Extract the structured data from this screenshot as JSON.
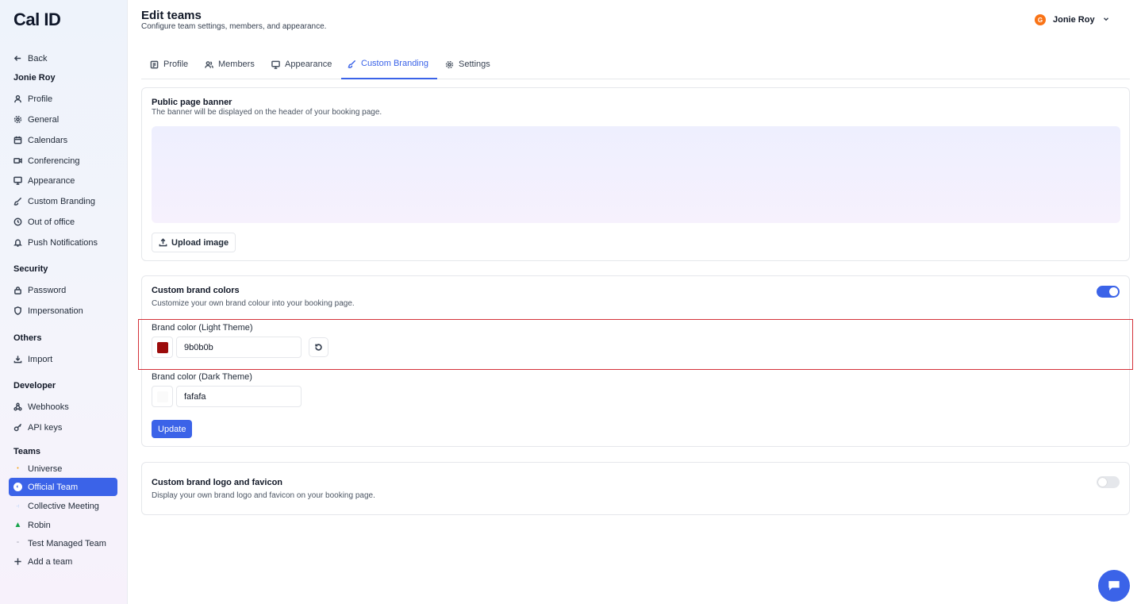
{
  "app": {
    "logo": "Cal ID"
  },
  "sidebar": {
    "back": "Back",
    "user_section": "Jonie Roy",
    "items": [
      {
        "label": "Profile",
        "icon": "user-icon"
      },
      {
        "label": "General",
        "icon": "gear-icon"
      },
      {
        "label": "Calendars",
        "icon": "calendar-icon"
      },
      {
        "label": "Conferencing",
        "icon": "video-icon"
      },
      {
        "label": "Appearance",
        "icon": "monitor-icon"
      },
      {
        "label": "Custom Branding",
        "icon": "brush-icon"
      },
      {
        "label": "Out of office",
        "icon": "clock-icon"
      },
      {
        "label": "Push Notifications",
        "icon": "bell-icon"
      }
    ],
    "security_title": "Security",
    "security_items": [
      {
        "label": "Password",
        "icon": "lock-icon"
      },
      {
        "label": "Impersonation",
        "icon": "shield-icon"
      }
    ],
    "others_title": "Others",
    "others_items": [
      {
        "label": "Import",
        "icon": "download-icon"
      }
    ],
    "developer_title": "Developer",
    "developer_items": [
      {
        "label": "Webhooks",
        "icon": "webhook-icon"
      },
      {
        "label": "API keys",
        "icon": "key-icon"
      }
    ],
    "teams_title": "Teams",
    "teams": [
      {
        "label": "Universe"
      },
      {
        "label": "Official Team"
      },
      {
        "label": "Collective Meeting"
      },
      {
        "label": "Robin"
      },
      {
        "label": "Test Managed Team"
      }
    ],
    "add_team": "Add a team"
  },
  "header": {
    "title": "Edit teams",
    "subtitle": "Configure team settings, members, and appearance.",
    "user_initial": "G",
    "user_name": "Jonie Roy"
  },
  "tabs": [
    {
      "label": "Profile"
    },
    {
      "label": "Members"
    },
    {
      "label": "Appearance"
    },
    {
      "label": "Custom Branding"
    },
    {
      "label": "Settings"
    }
  ],
  "banner_card": {
    "title": "Public page banner",
    "description": "The banner will be displayed on the header of your booking page.",
    "upload_label": "Upload image"
  },
  "brand_colors_card": {
    "title": "Custom brand colors",
    "description": "Customize your own brand colour into your booking page.",
    "enabled": true,
    "light_label": "Brand color (Light Theme)",
    "light_value": "9b0b0b",
    "light_color": "#9b0b0b",
    "dark_label": "Brand color (Dark Theme)",
    "dark_value": "fafafa",
    "dark_color": "#fafafa",
    "update_label": "Update"
  },
  "logo_card": {
    "title": "Custom brand logo and favicon",
    "description": "Display your own brand logo and favicon on your booking page.",
    "enabled": false
  },
  "colors": {
    "accent": "#3b63e8",
    "highlight": "#d4323a"
  }
}
